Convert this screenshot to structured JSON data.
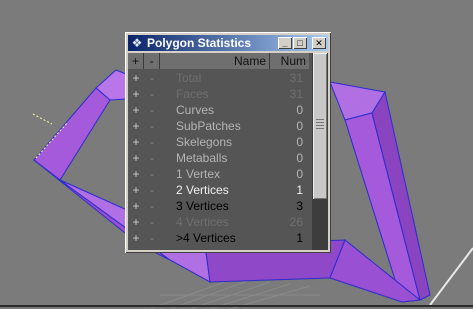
{
  "window": {
    "title": "Polygon Statistics",
    "icon": "wolf-icon",
    "buttons": {
      "minimize": "_",
      "maximize": "□",
      "close": "✕"
    }
  },
  "table": {
    "headers": {
      "plus": "+",
      "minus": "-",
      "name": "Name",
      "num": "Num"
    },
    "rows": [
      {
        "plus": "+",
        "minus": "-",
        "name": "Total",
        "num": "31",
        "style": "dim"
      },
      {
        "plus": "+",
        "minus": "-",
        "name": "Faces",
        "num": "31",
        "style": "dim"
      },
      {
        "plus": "+",
        "minus": "-",
        "name": "Curves",
        "num": "0",
        "style": "normal"
      },
      {
        "plus": "+",
        "minus": "-",
        "name": "SubPatches",
        "num": "0",
        "style": "normal"
      },
      {
        "plus": "+",
        "minus": "-",
        "name": "Skelegons",
        "num": "0",
        "style": "normal"
      },
      {
        "plus": "+",
        "minus": "-",
        "name": "Metaballs",
        "num": "0",
        "style": "normal"
      },
      {
        "plus": "+",
        "minus": "-",
        "name": "1 Vertex",
        "num": "0",
        "style": "normal"
      },
      {
        "plus": "+",
        "minus": "-",
        "name": "2 Vertices",
        "num": "1",
        "style": "bright"
      },
      {
        "plus": "+",
        "minus": "-",
        "name": "3 Vertices",
        "num": "3",
        "style": "black"
      },
      {
        "plus": "+",
        "minus": "-",
        "name": "4 Vertices",
        "num": "26",
        "style": "dim"
      },
      {
        "plus": "+",
        "minus": "-",
        "name": ">4 Vertices",
        "num": "1",
        "style": "black"
      }
    ]
  },
  "scrollbar": {
    "position_fraction": 0.0,
    "visible_fraction": 0.74
  },
  "colors": {
    "viewport_bg": "#7b7b7b",
    "shape_fill": "#a45adb",
    "shape_edge": "#2b2bd0",
    "panel_bg": "#555555",
    "titlebar_start": "#0a246a",
    "titlebar_end": "#a6caf0"
  }
}
